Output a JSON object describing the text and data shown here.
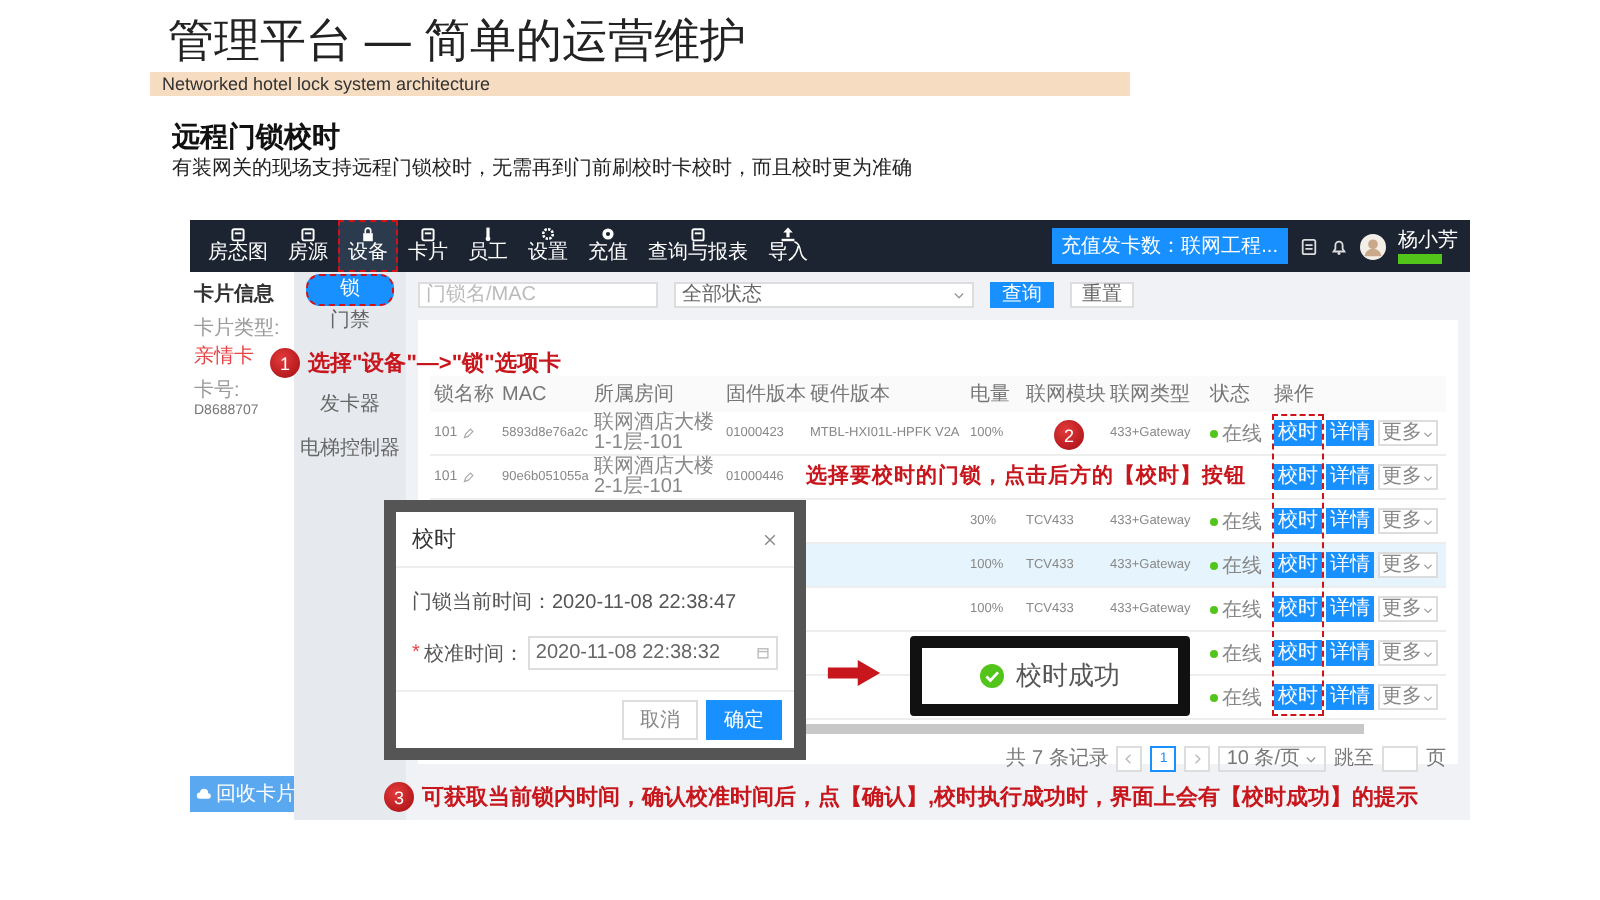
{
  "slide": {
    "title": "管理平台 — 简单的运营维护",
    "subtitle": "Networked hotel lock system architecture",
    "heading": "远程门锁校时",
    "description": "有装网关的现场支持远程门锁校时，无需再到门前刷校时卡校时，而且校时更为准确"
  },
  "app": {
    "nav": [
      {
        "label": "房态图",
        "selected": false,
        "marked": false
      },
      {
        "label": "房源",
        "selected": false,
        "marked": false
      },
      {
        "label": "设备",
        "selected": true,
        "marked": true
      },
      {
        "label": "卡片",
        "selected": false,
        "marked": false
      },
      {
        "label": "员工",
        "selected": false,
        "marked": false
      },
      {
        "label": "设置",
        "selected": false,
        "marked": false
      },
      {
        "label": "充值",
        "selected": false,
        "marked": false
      },
      {
        "label": "查询与报表",
        "selected": false,
        "marked": false
      },
      {
        "label": "导入",
        "selected": false,
        "marked": false
      }
    ],
    "notice": "充值发卡数：联网工程...",
    "user": "杨小芳",
    "card_info": {
      "title": "卡片信息",
      "type_label": "卡片类型:",
      "type_value": "亲情卡",
      "number_label": "卡号:",
      "number_value": "D8688707"
    },
    "recycle_button": "回收卡片",
    "device_tabs": [
      {
        "label": "锁",
        "selected": true,
        "marked": true
      },
      {
        "label": "门禁",
        "selected": false,
        "marked": false
      },
      {
        "label": "发卡器",
        "selected": false,
        "marked": false
      },
      {
        "label": "电梯控制器",
        "selected": false,
        "marked": false
      }
    ],
    "search": {
      "placeholder": "门锁名/MAC"
    },
    "status_filter": "全部状态",
    "query_button": "查询",
    "reset_button": "重置",
    "table": {
      "columns": [
        "锁名称",
        "MAC",
        "所属房间",
        "固件版本",
        "硬件版本",
        "电量",
        "联网模块",
        "联网类型",
        "状态",
        "操作"
      ],
      "actions_marked": true,
      "rows": [
        {
          "highlighted": false,
          "name": "101",
          "mac": "5893d8e76a2c",
          "room": "联网酒店大楼1-1层-101",
          "firmware": "01000423",
          "hardware": "MTBL-HXI01L-HPFK V2A",
          "battery": "100%",
          "network": "433+Gateway",
          "status": "在线",
          "actions": [
            "校时",
            "详情",
            "更多"
          ]
        },
        {
          "highlighted": false,
          "name": "101",
          "mac": "90e6b051055a",
          "room": "联网酒店大楼2-1层-101",
          "firmware": "01000446",
          "actions": [
            "校时",
            "详情",
            "更多"
          ]
        },
        {
          "highlighted": false,
          "battery": "30%",
          "module": "TCV433",
          "network": "433+Gateway",
          "status": "在线",
          "actions": [
            "校时",
            "详情",
            "更多"
          ]
        },
        {
          "highlighted": true,
          "battery": "100%",
          "module": "TCV433",
          "network": "433+Gateway",
          "status": "在线",
          "actions": [
            "校时",
            "详情",
            "更多"
          ]
        },
        {
          "highlighted": false,
          "battery": "100%",
          "module": "TCV433",
          "network": "433+Gateway",
          "status": "在线",
          "actions": [
            "校时",
            "详情",
            "更多"
          ]
        },
        {
          "highlighted": false,
          "status": "在线",
          "actions": [
            "校时",
            "详情",
            "更多"
          ]
        },
        {
          "highlighted": false,
          "status": "在线",
          "actions": [
            "校时",
            "详情",
            "更多"
          ]
        }
      ]
    },
    "pagination": {
      "total": "共 7 条记录",
      "pages": [
        {
          "label": "1",
          "selected": true
        }
      ],
      "page_size": "10 条/页",
      "jump_label": "跳至",
      "jump_suffix": "页"
    },
    "dialog": {
      "title": "校时",
      "current_label": "门锁当前时间：",
      "current_value": "2020-11-08 22:38:47",
      "field_label": "校准时间：",
      "required_mark": "*",
      "field_value": "2020-11-08 22:38:32",
      "cancel": "取消",
      "confirm": "确定"
    },
    "toast": {
      "text": "校时成功"
    }
  },
  "annotations": [
    {
      "number": "1",
      "text": "选择\"设备\"—>\"锁\"选项卡"
    },
    {
      "number": "2",
      "text": "选择要校时的门锁，点击后方的【校时】按钮"
    },
    {
      "number": "3",
      "text": "可获取当前锁内时间，确认校准时间后，点【确认】,校时执行成功时，界面上会有【校时成功】的提示"
    }
  ]
}
